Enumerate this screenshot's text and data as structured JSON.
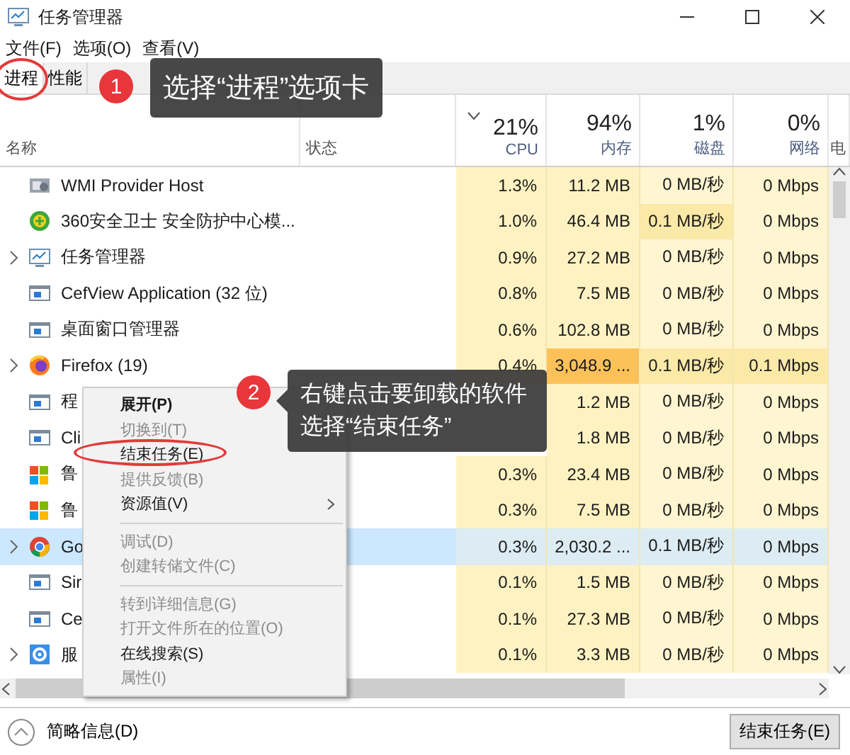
{
  "window": {
    "title": "任务管理器"
  },
  "menu_bar": [
    "文件(F)",
    "选项(O)",
    "查看(V)"
  ],
  "tabs": [
    {
      "label": "进程",
      "selected": true
    },
    {
      "label": "性能",
      "selected": false
    }
  ],
  "table": {
    "columns": [
      {
        "label": "名称",
        "sorted": false
      },
      {
        "label": "状态",
        "sorted": false
      },
      {
        "usage": "21%",
        "label": "CPU",
        "sorted": true
      },
      {
        "usage": "94%",
        "label": "内存",
        "sorted": false
      },
      {
        "usage": "1%",
        "label": "磁盘",
        "sorted": false
      },
      {
        "usage": "0%",
        "label": "网络",
        "sorted": false
      },
      {
        "label": "电",
        "sorted": false
      }
    ],
    "rows": [
      {
        "expandable": false,
        "selected": false,
        "cells": [
          "WMI Provider Host",
          "",
          "1.3%",
          "11.2 MB",
          "0 MB/秒",
          "0 Mbps"
        ]
      },
      {
        "expandable": false,
        "selected": false,
        "cells": [
          "360安全卫士 安全防护中心模...",
          "",
          "1.0%",
          "46.4 MB",
          {
            "text": "0.1 MB/秒",
            "color": "#fbe9a8"
          },
          "0 Mbps"
        ]
      },
      {
        "expandable": true,
        "selected": false,
        "cells": [
          "任务管理器",
          "",
          "0.9%",
          "27.2 MB",
          "0 MB/秒",
          "0 Mbps"
        ]
      },
      {
        "expandable": false,
        "selected": false,
        "cells": [
          "CefView Application (32 位)",
          "",
          "0.8%",
          "7.5 MB",
          "0 MB/秒",
          "0 Mbps"
        ]
      },
      {
        "expandable": false,
        "selected": false,
        "cells": [
          "桌面窗口管理器",
          "",
          "0.6%",
          "102.8 MB",
          "0 MB/秒",
          "0 Mbps"
        ]
      },
      {
        "expandable": true,
        "selected": false,
        "cells": [
          "Firefox (19)",
          "",
          "0.4%",
          {
            "text": "3,048.9 ...",
            "color": "#fdc15a"
          },
          {
            "text": "0.1 MB/秒",
            "color": "#fbe9a8"
          },
          {
            "text": "0.1 Mbps",
            "color": "#fbe9a8"
          }
        ]
      },
      {
        "expandable": false,
        "selected": false,
        "cells": [
          "程",
          "",
          null,
          "1.2 MB",
          "0 MB/秒",
          "0 Mbps"
        ]
      },
      {
        "expandable": false,
        "selected": false,
        "cells": [
          "Cli",
          "",
          null,
          "1.8 MB",
          "0 MB/秒",
          "0 Mbps"
        ]
      },
      {
        "expandable": false,
        "selected": false,
        "cells": [
          "鲁",
          "",
          "0.3%",
          "23.4 MB",
          "0 MB/秒",
          "0 Mbps"
        ]
      },
      {
        "expandable": false,
        "selected": false,
        "cells": [
          "鲁",
          "",
          "0.3%",
          "7.5 MB",
          "0 MB/秒",
          "0 Mbps"
        ]
      },
      {
        "expandable": true,
        "selected": true,
        "cells": [
          "Go",
          "",
          "0.3%",
          "2,030.2 ...",
          "0.1 MB/秒",
          "0 Mbps"
        ]
      },
      {
        "expandable": false,
        "selected": false,
        "cells": [
          "Sir",
          "",
          "0.1%",
          "1.5 MB",
          "0 MB/秒",
          "0 Mbps"
        ]
      },
      {
        "expandable": false,
        "selected": false,
        "cells": [
          "Ce",
          "",
          "0.1%",
          "27.3 MB",
          "0 MB/秒",
          "0 Mbps"
        ]
      },
      {
        "expandable": true,
        "selected": false,
        "cells": [
          "服",
          "",
          "0.1%",
          "3.3 MB",
          "0 MB/秒",
          "0 Mbps"
        ]
      }
    ]
  },
  "context_menu": {
    "items": [
      {
        "kind": "item",
        "label": "展开(P)",
        "default": true,
        "disabled": false
      },
      {
        "kind": "item",
        "label": "切换到(T)",
        "disabled": true
      },
      {
        "kind": "item",
        "label": "结束任务(E)",
        "disabled": false
      },
      {
        "kind": "item",
        "label": "提供反馈(B)",
        "disabled": true
      },
      {
        "kind": "item",
        "label": "资源值(V)",
        "disabled": false,
        "submenu": true
      },
      {
        "kind": "separator"
      },
      {
        "kind": "item",
        "label": "调试(D)",
        "disabled": true
      },
      {
        "kind": "item",
        "label": "创建转储文件(C)",
        "disabled": true
      },
      {
        "kind": "separator"
      },
      {
        "kind": "item",
        "label": "转到详细信息(G)",
        "disabled": true
      },
      {
        "kind": "item",
        "label": "打开文件所在的位置(O)",
        "disabled": true
      },
      {
        "kind": "item",
        "label": "在线搜索(S)",
        "disabled": false
      },
      {
        "kind": "item",
        "label": "属性(I)",
        "disabled": true
      }
    ]
  },
  "footer": {
    "details_toggle": "简略信息(D)",
    "end_task_button": "结束任务(E)"
  },
  "annotations": [
    {
      "number": "1",
      "lines": [
        "选择“进程”选项卡"
      ]
    },
    {
      "number": "2",
      "lines": [
        "右键点击要卸载的软件",
        "选择“结束任务”"
      ]
    }
  ]
}
